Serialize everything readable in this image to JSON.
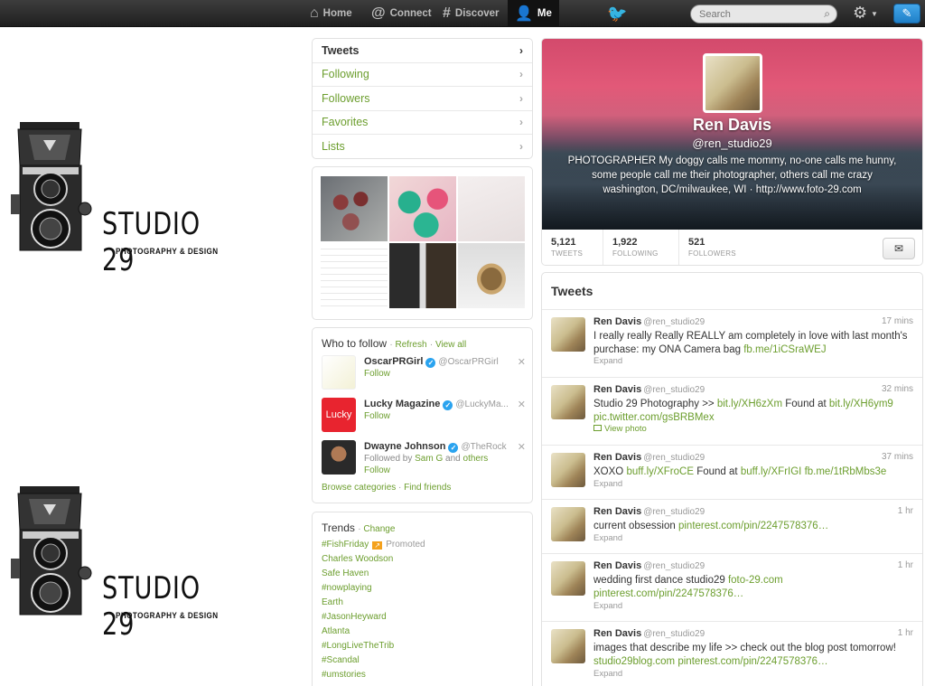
{
  "nav": {
    "home": "Home",
    "connect": "Connect",
    "discover": "Discover",
    "me": "Me",
    "search_placeholder": "Search"
  },
  "background": {
    "brand": "STUDIO 29",
    "subtitle": "PHOTOGRAPHY & DESIGN"
  },
  "profile_nav": {
    "items": [
      "Tweets",
      "Following",
      "Followers",
      "Favorites",
      "Lists"
    ]
  },
  "who_to_follow": {
    "title": "Who to follow",
    "refresh": "Refresh",
    "view_all": "View all",
    "suggestions": [
      {
        "name": "OscarPRGirl",
        "handle": "@OscarPRGirl",
        "context": "",
        "follow": "Follow"
      },
      {
        "name": "Lucky Magazine",
        "handle": "@LuckyMa...",
        "context": "",
        "follow": "Follow"
      },
      {
        "name": "Dwayne Johnson",
        "handle": "@TheRock",
        "context_prefix": "Followed by",
        "context_user": "Sam G",
        "context_and": "and",
        "context_others": "others",
        "follow": "Follow"
      }
    ],
    "browse_categories": "Browse categories",
    "find_friends": "Find friends"
  },
  "trends": {
    "title": "Trends",
    "change": "Change",
    "promoted_label": "Promoted",
    "items": [
      "#FishFriday",
      "Charles Woodson",
      "Safe Haven",
      "#nowplaying",
      "Earth",
      "#JasonHeyward",
      "Atlanta",
      "#LongLiveTheTrib",
      "#Scandal",
      "#umstories"
    ]
  },
  "profile": {
    "name": "Ren Davis",
    "handle": "@ren_studio29",
    "bio": "PHOTOGRAPHER My doggy calls me mommy, no-one calls me hunny, some people call me their photographer, others call me crazy",
    "location": "washington, DC/milwaukee, WI",
    "separator": "·",
    "url": "http://www.foto-29.com",
    "stats": [
      {
        "value": "5,121",
        "label": "TWEETS"
      },
      {
        "value": "1,922",
        "label": "FOLLOWING"
      },
      {
        "value": "521",
        "label": "FOLLOWERS"
      }
    ]
  },
  "timeline": {
    "title": "Tweets",
    "tweets": [
      {
        "name": "Ren Davis",
        "handle": "@ren_studio29",
        "time": "17 mins",
        "text": "I really really Really REALLY am completely in love with last month's purchase: my ONA Camera bag",
        "links": [
          "fb.me/1iCSraWEJ"
        ],
        "action": "Expand"
      },
      {
        "name": "Ren Davis",
        "handle": "@ren_studio29",
        "time": "32 mins",
        "text": "Studio 29 Photography >>",
        "links": [
          "bit.ly/XH6zXm",
          "Found at",
          "bit.ly/XH6ym9",
          "pic.twitter.com/gsBRBMex"
        ],
        "view_photo": "View photo",
        "action": "Expand"
      },
      {
        "name": "Ren Davis",
        "handle": "@ren_studio29",
        "time": "37 mins",
        "text": "XOXO",
        "links": [
          "buff.ly/XFroCE",
          "Found at",
          "buff.ly/XFrIGI",
          "fb.me/1tRbMbs3e"
        ],
        "action": "Expand"
      },
      {
        "name": "Ren Davis",
        "handle": "@ren_studio29",
        "time": "1 hr",
        "text": "current obsession",
        "links": [
          "pinterest.com/pin/2247578376…"
        ],
        "action": "Expand"
      },
      {
        "name": "Ren Davis",
        "handle": "@ren_studio29",
        "time": "1 hr",
        "text": "wedding first dance studio29",
        "links": [
          "foto-29.com",
          "pinterest.com/pin/2247578376…"
        ],
        "action": "Expand"
      },
      {
        "name": "Ren Davis",
        "handle": "@ren_studio29",
        "time": "1 hr",
        "text": "images that describe my life >> check out the blog post tomorrow!",
        "links": [
          "studio29blog.com",
          "pinterest.com/pin/2247578376…"
        ],
        "action": "Expand"
      }
    ]
  },
  "colors": {
    "link": "#6c9e2e",
    "topbar": "#2b2b2b",
    "accent": "#2aa3ef"
  },
  "media": {
    "thumb_lucky_text": "Lucky"
  }
}
